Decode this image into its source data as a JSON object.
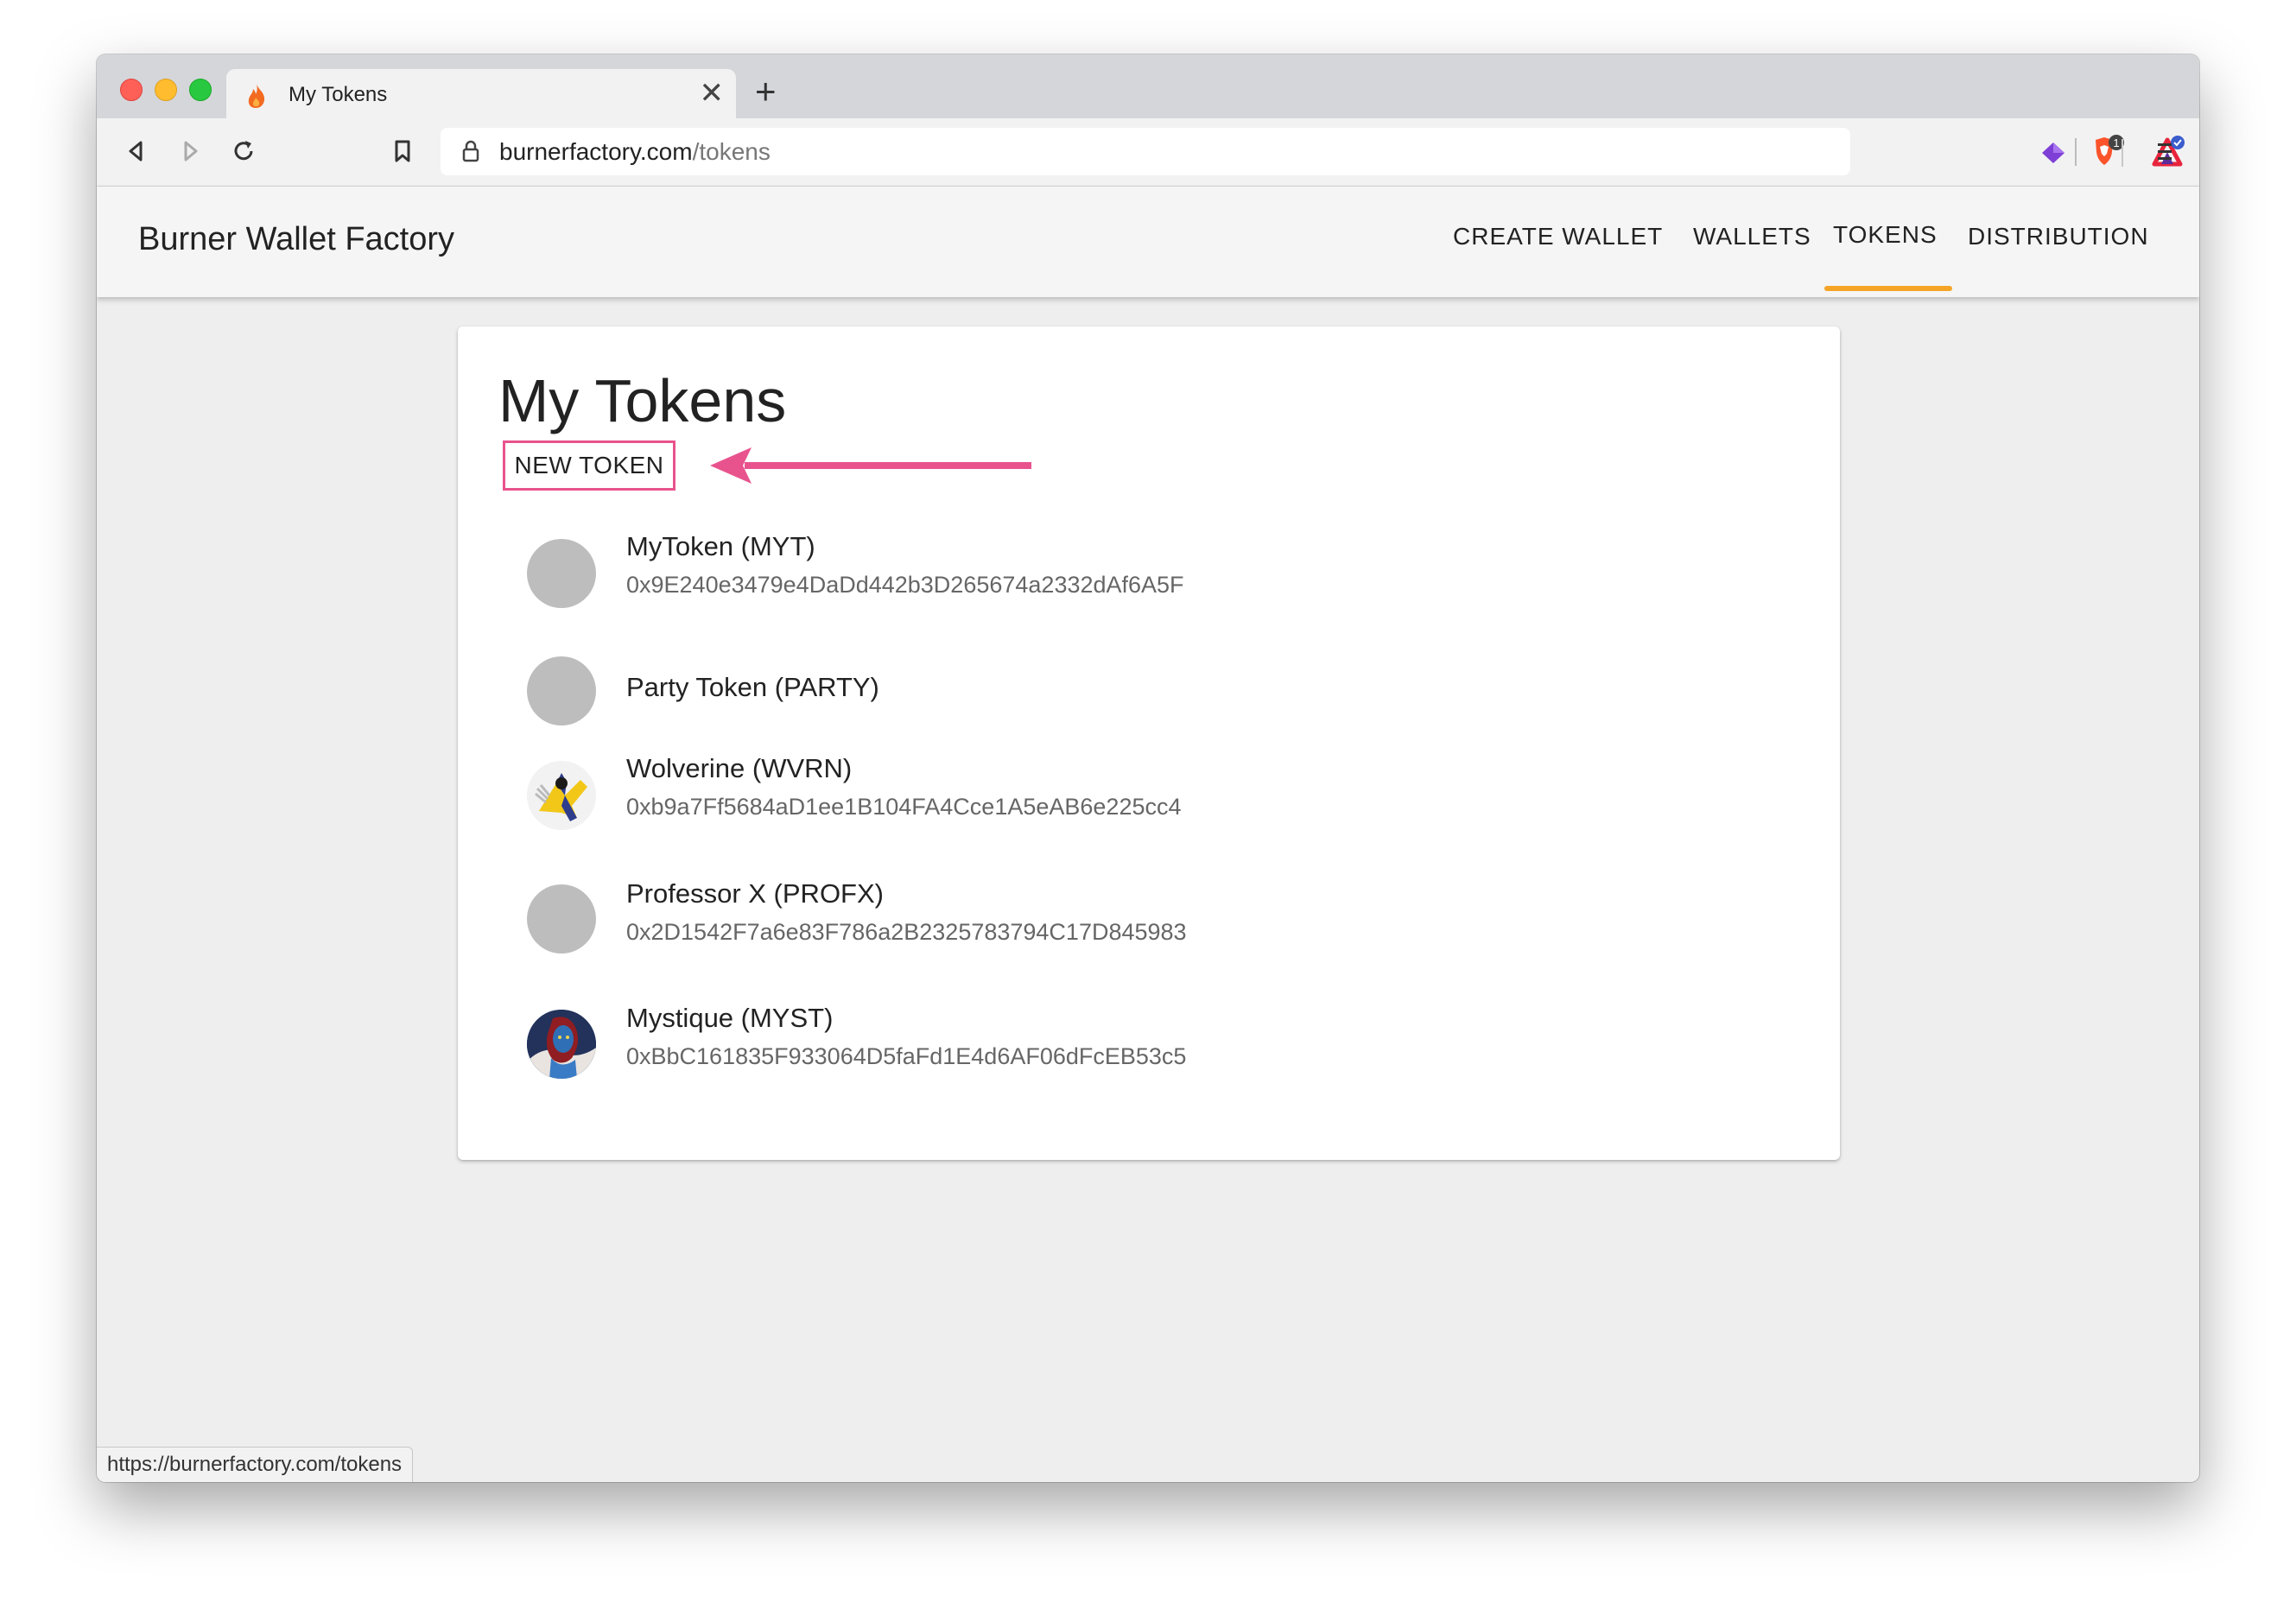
{
  "browser": {
    "tab_title": "My Tokens",
    "tab_close": "✕",
    "new_tab": "+",
    "url_host": "burnerfactory.com",
    "url_path": "/tokens",
    "brave_shield_count": "1",
    "status_url": "https://burnerfactory.com/tokens"
  },
  "app": {
    "title": "Burner Wallet Factory",
    "nav": [
      {
        "label": "CREATE WALLET"
      },
      {
        "label": "WALLETS"
      },
      {
        "label": "TOKENS",
        "active": true
      },
      {
        "label": "DISTRIBUTION"
      }
    ]
  },
  "page": {
    "title": "My Tokens",
    "new_token_label": "NEW TOKEN",
    "tokens": [
      {
        "name": "MyToken (MYT)",
        "address": "0x9E240e3479e4DaDd442b3D265674a2332dAf6A5F",
        "avatar": "placeholder"
      },
      {
        "name": "Party Token (PARTY)",
        "address": "",
        "avatar": "placeholder"
      },
      {
        "name": "Wolverine (WVRN)",
        "address": "0xb9a7Ff5684aD1ee1B104FA4Cce1A5eAB6e225cc4",
        "avatar": "wolverine-image"
      },
      {
        "name": "Professor X (PROFX)",
        "address": "0x2D1542F7a6e83F786a2B2325783794C17D845983",
        "avatar": "placeholder"
      },
      {
        "name": "Mystique (MYST)",
        "address": "0xBbC161835F933064D5faFd1E4d6AF06dFcEB53c5",
        "avatar": "mystique-image"
      }
    ]
  },
  "colors": {
    "accent": "#f5a425",
    "annotation": "#e8538d",
    "avatar_placeholder": "#bdbdbd"
  }
}
